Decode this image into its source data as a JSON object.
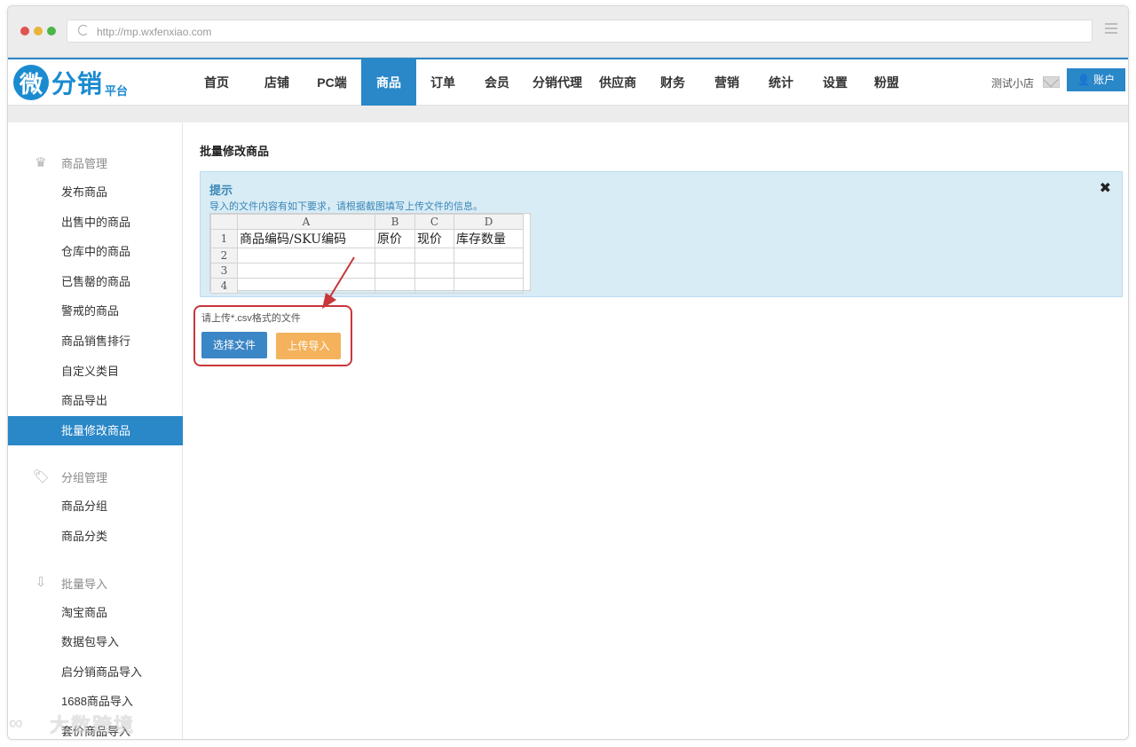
{
  "browser": {
    "url": "http://mp.wxfenxiao.com",
    "dots": [
      "#e0534f",
      "#e8b43a",
      "#4cb748"
    ]
  },
  "header": {
    "logo_mark": "微",
    "logo_text": "分销",
    "logo_sub": "平台",
    "nav": [
      "首页",
      "店铺",
      "PC端",
      "商品",
      "订单",
      "会员",
      "分销代理",
      "供应商",
      "财务",
      "营销",
      "统计",
      "设置",
      "粉盟"
    ],
    "active_nav": "商品",
    "store_name": "测试小店",
    "account_label": "账户",
    "accent_color": "#2a87c8"
  },
  "sidebar": {
    "groups": [
      {
        "title": "商品管理",
        "icon": "crown-icon",
        "items": [
          "发布商品",
          "出售中的商品",
          "仓库中的商品",
          "已售罄的商品",
          "警戒的商品",
          "商品销售排行",
          "自定义类目",
          "商品导出",
          "批量修改商品"
        ]
      },
      {
        "title": "分组管理",
        "icon": "tag-icon",
        "items": [
          "商品分组",
          "商品分类"
        ]
      },
      {
        "title": "批量导入",
        "icon": "download-icon",
        "items": [
          "淘宝商品",
          "数据包导入",
          "启分销商品导入",
          "1688商品导入",
          "套价商品导入"
        ]
      }
    ],
    "active_item": "批量修改商品"
  },
  "main": {
    "page_title": "批量修改商品",
    "tip": {
      "title": "提示",
      "description": "导入的文件内容有如下要求，请根据截图填写上传文件的信息。",
      "close": "✖"
    },
    "sheet": {
      "columns": [
        "A",
        "B",
        "C",
        "D"
      ],
      "rows": [
        [
          "1",
          "商品编码/SKU编码",
          "原价",
          "现价",
          "库存数量"
        ],
        [
          "2",
          "",
          "",
          "",
          ""
        ],
        [
          "3",
          "",
          "",
          "",
          ""
        ],
        [
          "4",
          "",
          "",
          "",
          ""
        ]
      ]
    },
    "hint": "请上传*.csv格式的文件",
    "select_button": "选择文件",
    "upload_button": "上传导入"
  },
  "watermark": {
    "text": "大数跨境"
  }
}
